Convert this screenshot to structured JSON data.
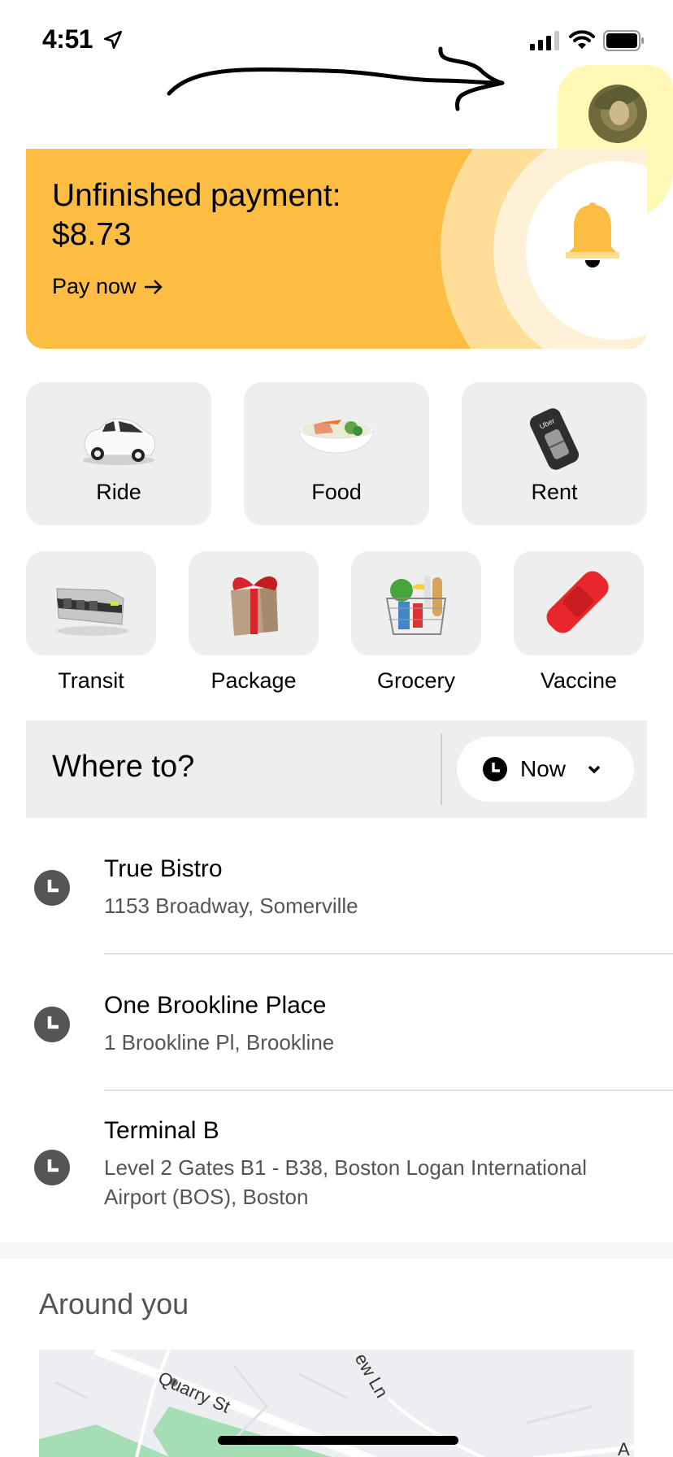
{
  "status_bar": {
    "time": "4:51",
    "location_icon": "location-arrow-icon",
    "signal_icon": "cellular-signal-icon",
    "wifi_icon": "wifi-icon",
    "battery_icon": "battery-icon"
  },
  "annotation": {
    "type": "hand-drawn arrow pointing to profile avatar, avatar highlighted in yellow",
    "highlight_color": "#FFF478"
  },
  "profile": {
    "avatar_icon": "profile-avatar"
  },
  "payment_banner": {
    "title": "Unfinished payment:",
    "amount": "$8.73",
    "link_label": "Pay now",
    "link_icon": "arrow-right-icon",
    "bell_icon": "bell-icon",
    "background_color": "#FDBD43"
  },
  "services": {
    "primary": [
      {
        "label": "Ride",
        "icon": "car-icon"
      },
      {
        "label": "Food",
        "icon": "food-bowl-icon"
      },
      {
        "label": "Rent",
        "icon": "car-key-icon"
      }
    ],
    "secondary": [
      {
        "label": "Transit",
        "icon": "train-icon"
      },
      {
        "label": "Package",
        "icon": "gift-box-icon"
      },
      {
        "label": "Grocery",
        "icon": "grocery-basket-icon"
      },
      {
        "label": "Vaccine",
        "icon": "bandage-icon"
      }
    ]
  },
  "search": {
    "placeholder": "Where to?",
    "schedule_label": "Now",
    "schedule_icon": "clock-icon",
    "dropdown_icon": "chevron-down-icon"
  },
  "recent_places": [
    {
      "name": "True Bistro",
      "address": "1153 Broadway, Somerville",
      "icon": "clock-icon"
    },
    {
      "name": "One Brookline Place",
      "address": "1 Brookline Pl, Brookline",
      "icon": "clock-icon"
    },
    {
      "name": "Terminal B",
      "address": "Level 2 Gates B1 - B38, Boston Logan International Airport (BOS), Boston",
      "icon": "clock-icon"
    }
  ],
  "around_you": {
    "title": "Around you",
    "map_labels": [
      "Quarry St",
      "ew Ln",
      "A"
    ]
  }
}
